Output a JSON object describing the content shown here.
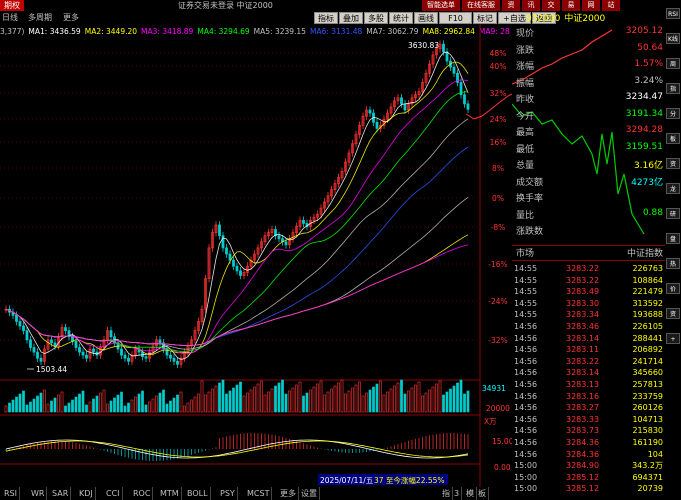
{
  "window": {
    "logo": "期权",
    "title": "证券交易未登录 中证2000",
    "topbar_buttons": [
      "智能选单",
      "在线客服",
      "资",
      "讯",
      "交",
      "易",
      "网",
      "站"
    ]
  },
  "toolbar": {
    "left_items": [
      "日线",
      "多周期",
      "更多"
    ],
    "right_buttons": [
      "指标",
      "叠加",
      "多股",
      "统计",
      "画线",
      "F10",
      "标记",
      "+自选",
      "返回"
    ]
  },
  "ma_row": [
    {
      "text": "3,377)",
      "color": "#c0c0c0"
    },
    {
      "text": "MA1: 3436.59",
      "color": "#ffffff"
    },
    {
      "text": "MA2: 3449.20",
      "color": "#ffff00"
    },
    {
      "text": "MA3: 3418.89",
      "color": "#ff00ff"
    },
    {
      "text": "MA4: 3294.69",
      "color": "#00ff00"
    },
    {
      "text": "MA5: 3239.15",
      "color": "#c0c0c0"
    },
    {
      "text": "MA6: 3131.48",
      "color": "#3355ff"
    },
    {
      "text": "MA7: 3062.79",
      "color": "#c0c0c0"
    },
    {
      "text": "MA8: 2962.84",
      "color": "#ffff00"
    },
    {
      "text": "MA9: 28",
      "color": "#ff00ff"
    }
  ],
  "chart": {
    "high_label": "3630.83",
    "low_label": "1503.44",
    "pct_labels": [
      "48%",
      "40%",
      "32%",
      "24%",
      "16%",
      "8%",
      "0%",
      "-8%",
      "-16%",
      "-24%",
      "-32%"
    ],
    "volume_label": "34931",
    "volume_sub": "20000",
    "volume_unit": "X万",
    "macd_labels": [
      "15.00",
      "0.00"
    ],
    "date_label": "2025/07/11/五",
    "note": "37 至今涨幅22.55%"
  },
  "quote": {
    "code": "932000",
    "name": "中证2000",
    "rows": [
      {
        "label": "现价",
        "value": "3205.12",
        "color": "#ff3333"
      },
      {
        "label": "涨跌",
        "value": "50.64",
        "color": "#ff3333"
      },
      {
        "label": "涨幅",
        "value": "1.57%",
        "color": "#ff3333"
      },
      {
        "label": "振幅",
        "value": "3.24%",
        "color": "#c0c0c0"
      },
      {
        "label": "昨收",
        "value": "3234.47",
        "color": "#ffffff"
      },
      {
        "label": "今开",
        "value": "3191.34",
        "color": "#00ff00"
      },
      {
        "label": "最高",
        "value": "3294.28",
        "color": "#ff3333"
      },
      {
        "label": "最低",
        "value": "3159.51",
        "color": "#00ff00"
      },
      {
        "label": "总量",
        "value": "3.16亿",
        "color": "#ffff00"
      },
      {
        "label": "成交额",
        "value": "4273亿",
        "color": "#00ffff"
      },
      {
        "label": "换手率",
        "value": "",
        "color": "#c0c0c0"
      },
      {
        "label": "量比",
        "value": "0.88",
        "color": "#00ff00"
      },
      {
        "label": "涨跌数",
        "value": "",
        "color": "#c0c0c0"
      }
    ],
    "market_label": "市场",
    "market_value": "中证指数"
  },
  "ticks": [
    {
      "time": "14:55",
      "price": "3283.22",
      "vol": "226763"
    },
    {
      "time": "14:55",
      "price": "3283.22",
      "vol": "108864"
    },
    {
      "time": "14:55",
      "price": "3283.49",
      "vol": "221479"
    },
    {
      "time": "14:55",
      "price": "3283.30",
      "vol": "313592"
    },
    {
      "time": "14:55",
      "price": "3283.34",
      "vol": "193688"
    },
    {
      "time": "14:56",
      "price": "3283.46",
      "vol": "226105"
    },
    {
      "time": "14:56",
      "price": "3283.14",
      "vol": "288441"
    },
    {
      "time": "14:56",
      "price": "3283.11",
      "vol": "206892"
    },
    {
      "time": "14:56",
      "price": "3283.22",
      "vol": "241714"
    },
    {
      "time": "14:56",
      "price": "3283.14",
      "vol": "345660"
    },
    {
      "time": "14:56",
      "price": "3283.13",
      "vol": "257813"
    },
    {
      "time": "14:56",
      "price": "3283.16",
      "vol": "233759"
    },
    {
      "time": "14:56",
      "price": "3283.27",
      "vol": "260126"
    },
    {
      "time": "14:56",
      "price": "3283.33",
      "vol": "104713"
    },
    {
      "time": "14:56",
      "price": "3283.73",
      "vol": "215830"
    },
    {
      "time": "14:56",
      "price": "3284.36",
      "vol": "161190"
    },
    {
      "time": "14:56",
      "price": "3284.36",
      "vol": "104"
    },
    {
      "time": "15:00",
      "price": "3284.90",
      "vol": "343.2万"
    },
    {
      "time": "15:00",
      "price": "3285.12",
      "vol": "694371"
    },
    {
      "time": "15:00",
      "price": "3285.12",
      "vol": "20739"
    }
  ],
  "sidebar": [
    "RSI",
    "K线",
    "周",
    "指",
    "分",
    "板",
    "资",
    "龙",
    "研",
    "盘",
    "热",
    "价",
    "资",
    "+"
  ],
  "bottom_tabs": [
    "RSI",
    "WR",
    "SAR",
    "KDJ",
    "CCI",
    "ROC",
    "MTM",
    "BOLL",
    "PSY",
    "MCST",
    "更多",
    "设置"
  ],
  "bottom_right": [
    "指",
    "3",
    "模",
    "板"
  ]
}
